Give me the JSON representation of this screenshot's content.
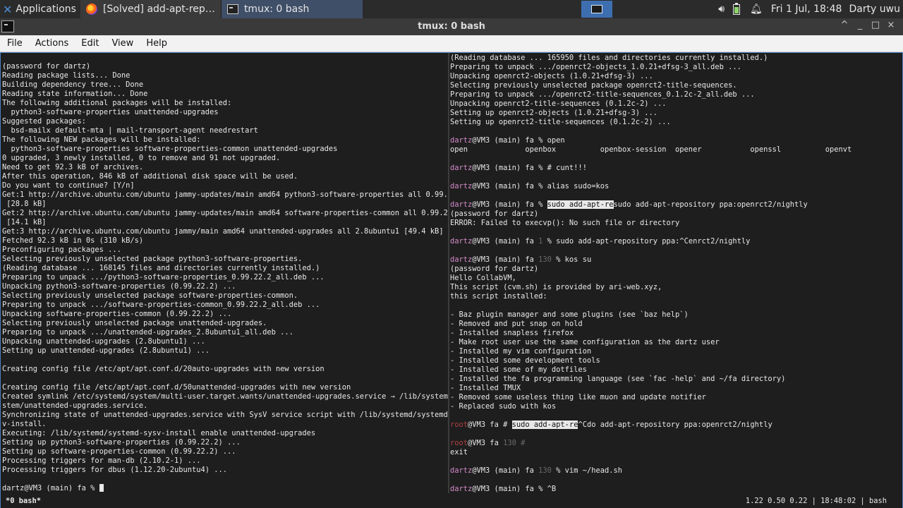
{
  "panel": {
    "applications": "Applications",
    "tasks": [
      {
        "label": "[Solved] add-apt-reposit...",
        "icon": "firefox-icon"
      },
      {
        "label": "tmux: 0 bash",
        "icon": "terminal-icon"
      }
    ],
    "clock": "Fri  1 Jul, 18:48",
    "user": "Darty uwu"
  },
  "window": {
    "title": "tmux: 0 bash",
    "buttons": [
      "^",
      "_",
      "□",
      "×"
    ]
  },
  "menu": [
    "File",
    "Actions",
    "Edit",
    "View",
    "Help"
  ],
  "left_pane": [
    "(password for dartz)",
    "Reading package lists... Done",
    "Building dependency tree... Done",
    "Reading state information... Done",
    "The following additional packages will be installed:",
    "  python3-software-properties unattended-upgrades",
    "Suggested packages:",
    "  bsd-mailx default-mta | mail-transport-agent needrestart",
    "The following NEW packages will be installed:",
    "  python3-software-properties software-properties-common unattended-upgrades",
    "0 upgraded, 3 newly installed, 0 to remove and 91 not upgraded.",
    "Need to get 92.3 kB of archives.",
    "After this operation, 846 kB of additional disk space will be used.",
    "Do you want to continue? [Y/n]",
    "Get:1 http://archive.ubuntu.com/ubuntu jammy-updates/main amd64 python3-software-properties all 0.99.22.2",
    " [28.8 kB]",
    "Get:2 http://archive.ubuntu.com/ubuntu jammy-updates/main amd64 software-properties-common all 0.99.22.2",
    " [14.1 kB]",
    "Get:3 http://archive.ubuntu.com/ubuntu jammy/main amd64 unattended-upgrades all 2.8ubuntu1 [49.4 kB]",
    "Fetched 92.3 kB in 0s (310 kB/s)",
    "Preconfiguring packages ...",
    "Selecting previously unselected package python3-software-properties.",
    "(Reading database ... 168145 files and directories currently installed.)",
    "Preparing to unpack .../python3-software-properties_0.99.22.2_all.deb ...",
    "Unpacking python3-software-properties (0.99.22.2) ...",
    "Selecting previously unselected package software-properties-common.",
    "Preparing to unpack .../software-properties-common_0.99.22.2_all.deb ...",
    "Unpacking software-properties-common (0.99.22.2) ...",
    "Selecting previously unselected package unattended-upgrades.",
    "Preparing to unpack .../unattended-upgrades_2.8ubuntu1_all.deb ...",
    "Unpacking unattended-upgrades (2.8ubuntu1) ...",
    "Setting up unattended-upgrades (2.8ubuntu1) ...",
    "",
    "Creating config file /etc/apt/apt.conf.d/20auto-upgrades with new version",
    "",
    "Creating config file /etc/apt/apt.conf.d/50unattended-upgrades with new version",
    "Created symlink /etc/systemd/system/multi-user.target.wants/unattended-upgrades.service → /lib/systemd/sy",
    "stem/unattended-upgrades.service.",
    "Synchronizing state of unattended-upgrades.service with SysV service script with /lib/systemd/systemd-sys",
    "v-install.",
    "Executing: /lib/systemd/systemd-sysv-install enable unattended-upgrades",
    "Setting up python3-software-properties (0.99.22.2) ...",
    "Setting up software-properties-common (0.99.22.2) ...",
    "Processing triggers for man-db (2.10.2-1) ...",
    "Processing triggers for dbus (1.12.20-2ubuntu4) ...",
    "",
    "dartz@VM3 (main) fa % "
  ],
  "right_pane": {
    "output_top": [
      "(Reading database ... 165950 files and directories currently installed.)",
      "Preparing to unpack .../openrct2-objects_1.0.21+dfsg-3_all.deb ...",
      "Unpacking openrct2-objects (1.0.21+dfsg-3) ...",
      "Selecting previously unselected package openrct2-title-sequences.",
      "Preparing to unpack .../openrct2-title-sequences_0.1.2c-2_all.deb ...",
      "Unpacking openrct2-title-sequences (0.1.2c-2) ...",
      "Setting up openrct2-objects (1.0.21+dfsg-3) ...",
      "Setting up openrct2-title-sequences (0.1.2c-2) ..."
    ],
    "prompt_user": "dartz",
    "prompt_host": "@VM3 (main) fa",
    "cmd_open": " % open",
    "completions": "open             openbox          openbox-session  opener           openssl          openvt",
    "cmd_cunt": " % # cunt!!!",
    "cmd_alias": " % alias sudo=kos",
    "cmd_sudo_hl": "sudo add-apt-re",
    "cmd_sudo_rest": "sudo add-apt-repository ppa:openrct2/nightly",
    "sudo_out": [
      "(password for dartz)",
      "ERROR: Failed to execvp(): No such file or directory"
    ],
    "prompt_short": "@VM3 (main) fa",
    "status_1": " 1 ",
    "cmd_cenrct": "% sudo add-apt-repository ppa:^Cenrct2/nightly",
    "status_130": " 130 ",
    "cmd_kos": "% kos su",
    "kos_out": [
      "(password for dartz)",
      "Hello CollabVM,",
      "This script (cvm.sh) is provided by ari-web.xyz,",
      "this script installed:",
      "",
      "- Baz plugin manager and some plugins (see `baz help`)",
      "- Removed and put snap on hold",
      "- Installed snapless firefox",
      "- Make root user use the same configuration as the dartz user",
      "- Installed my vim configuration",
      "- Installed some development tools",
      "- Installed some of my dotfiles",
      "- Installed the fa programming language (see `fac -help` and ~/fa directory)",
      "- Installed TMUX",
      "- Removed some useless thing like muon and update notifier",
      "- Replaced sudo with kos"
    ],
    "root_user": "root",
    "root_host": "@VM3 fa",
    "root_hash": " # ",
    "root_hl": "sudo add-apt-re",
    "root_rest": "^Cdo add-apt-repository ppa:openrct2/nightly",
    "root_130": " 130 #",
    "exit": "exit",
    "cmd_vim": "% vim ~/head.sh",
    "cmd_last": " % ^B"
  },
  "status": {
    "window": "*0 bash*",
    "info": "1.22 0.50 0.22 | 18:48:02 | bash"
  }
}
